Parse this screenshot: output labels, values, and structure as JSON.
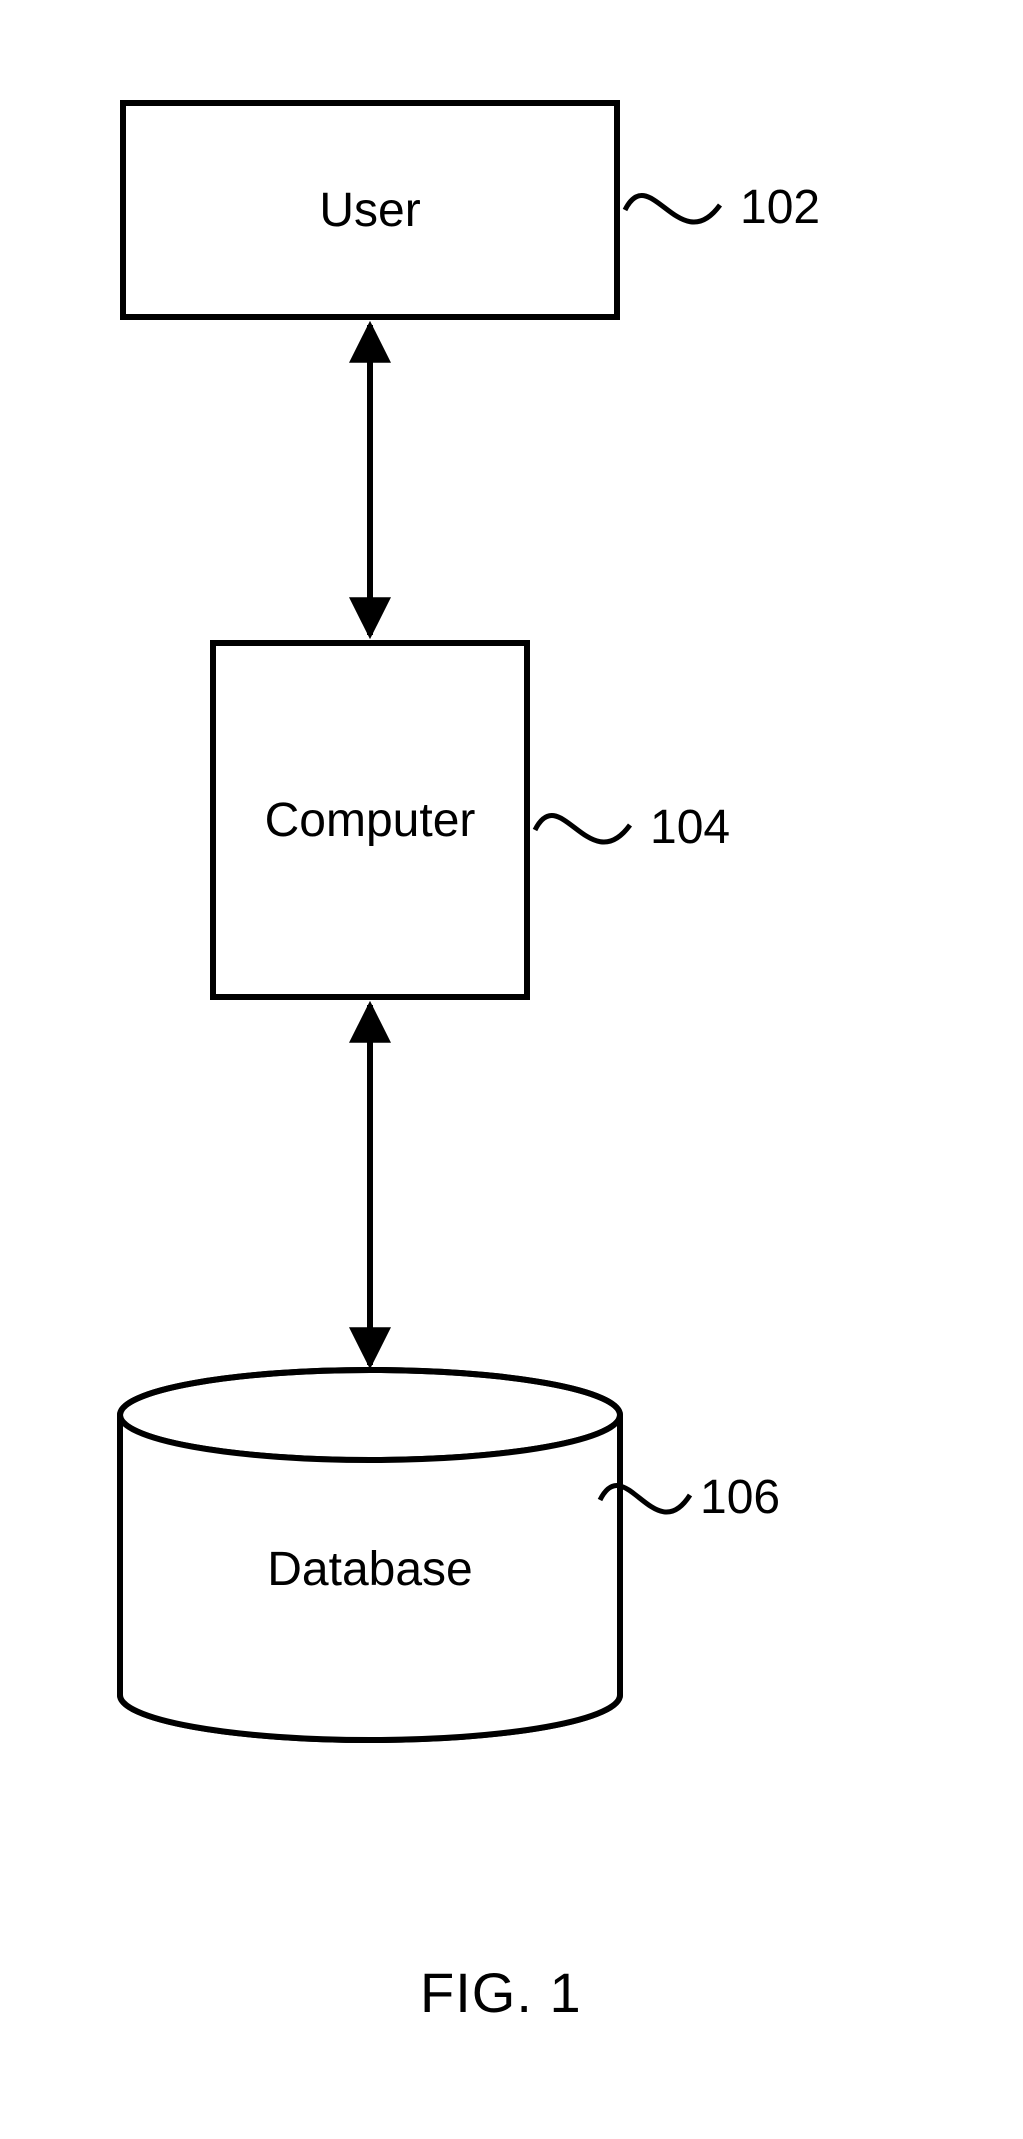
{
  "nodes": {
    "user": {
      "label": "User",
      "ref": "102"
    },
    "computer": {
      "label": "Computer",
      "ref": "104"
    },
    "database": {
      "label": "Database",
      "ref": "106"
    }
  },
  "caption": "FIG. 1"
}
